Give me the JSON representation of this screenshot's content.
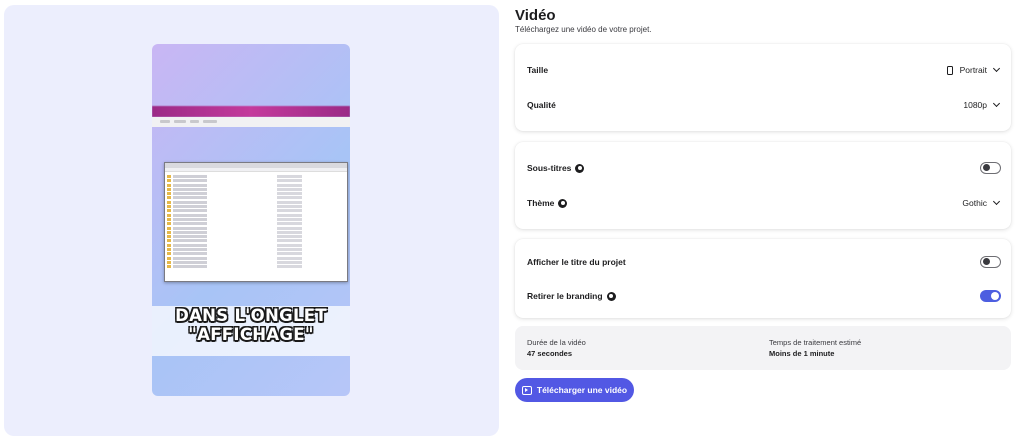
{
  "header": {
    "title": "Vidéo",
    "subtitle": "Téléchargez une vidéo de votre projet."
  },
  "preview": {
    "caption_line1": "DANS L'ONGLET",
    "caption_line2": "\"AFFICHAGE\""
  },
  "format_card": {
    "size_label": "Taille",
    "size_value": "Portrait",
    "size_icon": "phone-portrait-icon",
    "quality_label": "Qualité",
    "quality_value": "1080p"
  },
  "subtitle_card": {
    "subtitles_label": "Sous-titres",
    "subtitles_enabled": false,
    "theme_label": "Thème",
    "theme_value": "Gothic"
  },
  "branding_card": {
    "show_title_label": "Afficher le titre du projet",
    "show_title_enabled": false,
    "remove_branding_label": "Retirer le branding",
    "remove_branding_enabled": true
  },
  "info": {
    "duration_label": "Durée de la vidéo",
    "duration_value": "47 secondes",
    "processing_label": "Temps de traitement estimé",
    "processing_value": "Moins de 1 minute"
  },
  "download_button": {
    "label": "Télécharger une vidéo",
    "icon": "play-icon"
  },
  "colors": {
    "accent": "#5258e4",
    "preview_background": "#eceefd"
  }
}
